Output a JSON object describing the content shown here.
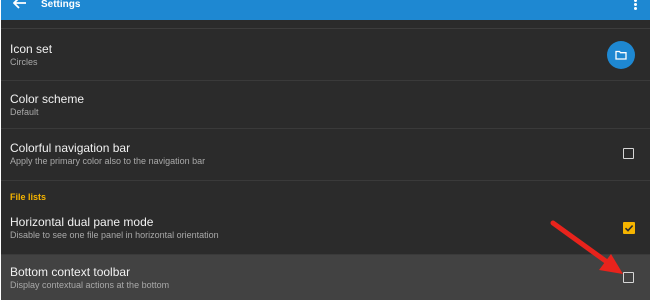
{
  "appbar": {
    "back_icon": "arrow-left-icon",
    "title": "Settings",
    "menu_icon": "more-vertical-icon",
    "color": "#1e88d2"
  },
  "settings": {
    "icon_set": {
      "title": "Icon set",
      "summary": "Circles",
      "action_icon": "folder-icon"
    },
    "color_scheme": {
      "title": "Color scheme",
      "summary": "Default"
    },
    "colorful_nav_bar": {
      "title": "Colorful navigation bar",
      "summary": "Apply the primary color also to the navigation bar",
      "checked": false
    },
    "section_file_lists": "File lists",
    "dual_pane": {
      "title": "Horizontal dual pane mode",
      "summary": "Disable to see one file panel in horizontal orientation",
      "checked": true
    },
    "bottom_toolbar": {
      "title": "Bottom context toolbar",
      "summary": "Display contextual actions at the bottom",
      "checked": false
    }
  },
  "annotation": {
    "arrow_color": "#e8231c",
    "target": "bottom_toolbar checkbox"
  },
  "colors": {
    "accent": "#f5b400",
    "background": "#2b2b2b",
    "primary": "#1e88d2"
  }
}
